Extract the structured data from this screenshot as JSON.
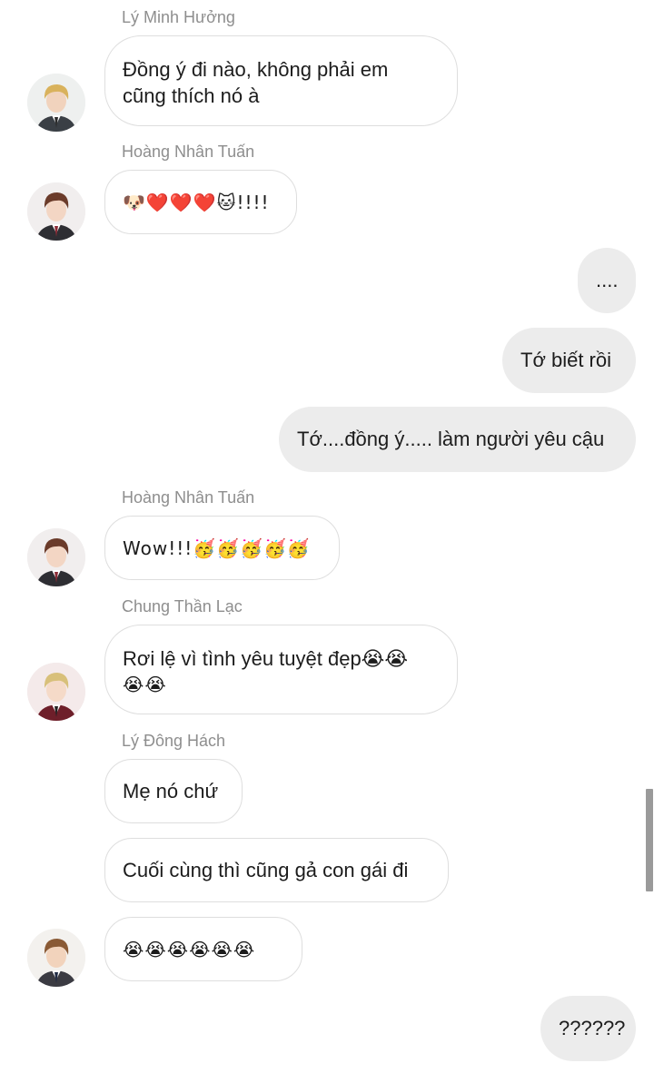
{
  "messages": [
    {
      "sender": "Lý Minh Hưởng",
      "text_line1": "Đồng ý đi nào, không phải em",
      "text_line2": "cũng thích nó à"
    },
    {
      "sender": "Hoàng Nhân Tuấn",
      "text": "🐶❤️❤️❤️🐱!!!!"
    },
    {
      "text": "...."
    },
    {
      "text": "Tớ biết rồi"
    },
    {
      "text": "Tớ....đồng ý..... làm người yêu cậu"
    },
    {
      "sender": "Hoàng Nhân Tuấn",
      "text": "Wow!!!🥳🥳🥳🥳🥳"
    },
    {
      "sender": "Chung Thần Lạc",
      "text_line1": "Rơi lệ vì tình yêu tuyệt đẹp😭😭",
      "text_line2": "😭😭"
    },
    {
      "sender": "Lý Đông Hách",
      "text": "Mẹ nó chứ"
    },
    {
      "text": "Cuối cùng thì cũng gả con gái đi"
    },
    {
      "text": "😭😭😭😭😭😭"
    },
    {
      "text": "??????"
    }
  ],
  "colors": {
    "incoming_bubble": "#ffffff",
    "incoming_border": "#dedede",
    "outgoing_bubble": "#ececec",
    "sender_name": "#8e8e8e",
    "text": "#1c1c1c"
  }
}
